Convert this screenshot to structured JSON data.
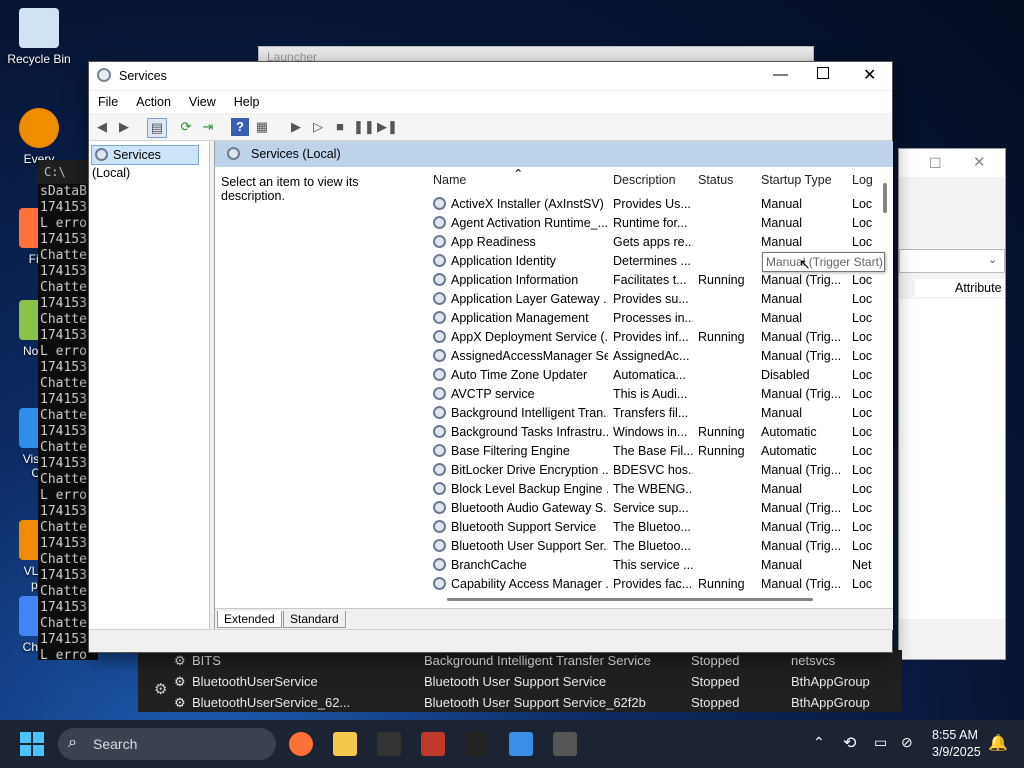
{
  "desktop_icons": [
    {
      "label": "Recycle Bin",
      "icon": "recycle-bin-icon"
    },
    {
      "label": "Every",
      "icon": "everything-search-icon"
    },
    {
      "label": "Fire",
      "icon": "firefox-icon"
    },
    {
      "label": "Notep",
      "icon": "notepad-icon"
    },
    {
      "label": "Visual",
      "label2": "Co",
      "icon": "vscode-icon"
    },
    {
      "label": "VLC r",
      "label2": "pla",
      "icon": "vlc-icon"
    },
    {
      "label": "Chron",
      "icon": "chrome-icon"
    }
  ],
  "console": {
    "title": "C:\\",
    "lines": [
      "sDataB",
      "174153",
      "L erro",
      "174153",
      "Chatte",
      "174153",
      "Chatte",
      "174153",
      "Chatte",
      "174153",
      "L erro",
      "174153",
      "Chatte",
      "174153",
      "Chatte",
      "174153",
      "Chatte",
      "174153",
      "Chatte",
      "L erro",
      "174153",
      "Chatte",
      "174153",
      "Chatte",
      "174153",
      "Chatte",
      "174153",
      "Chatte",
      "174153",
      "L erro"
    ]
  },
  "background_window": {
    "title": "Launcher"
  },
  "right_window": {
    "column_header": "Attribute"
  },
  "bottom_list": {
    "rows": [
      {
        "name": "BITS",
        "description": "Background Intelligent Transfer Service",
        "status": "Stopped",
        "group": "netsvcs"
      },
      {
        "name": "BluetoothUserService",
        "description": "Bluetooth User Support Service",
        "status": "Stopped",
        "group": "BthAppGroup"
      },
      {
        "name": "BluetoothUserService_62...",
        "description": "Bluetooth User Support Service_62f2b",
        "status": "Stopped",
        "group": "BthAppGroup"
      }
    ]
  },
  "services_window": {
    "title": "Services",
    "menu": [
      "File",
      "Action",
      "View",
      "Help"
    ],
    "tree_root": "Services (Local)",
    "panel_title": "Services (Local)",
    "description_prompt": "Select an item to view its description.",
    "columns": [
      "Name",
      "Description",
      "Status",
      "Startup Type",
      "Log"
    ],
    "rows": [
      {
        "name": "ActiveX Installer (AxInstSV)",
        "description": "Provides Us...",
        "status": "",
        "startup": "Manual",
        "log": "Loc"
      },
      {
        "name": "Agent Activation Runtime_...",
        "description": "Runtime for...",
        "status": "",
        "startup": "Manual",
        "log": "Loc"
      },
      {
        "name": "App Readiness",
        "description": "Gets apps re...",
        "status": "",
        "startup": "Manual",
        "log": "Loc"
      },
      {
        "name": "Application Identity",
        "description": "Determines ...",
        "status": "",
        "startup": "",
        "log": ""
      },
      {
        "name": "Application Information",
        "description": "Facilitates t...",
        "status": "Running",
        "startup": "Manual (Trig...",
        "log": "Loc"
      },
      {
        "name": "Application Layer Gateway ...",
        "description": "Provides su...",
        "status": "",
        "startup": "Manual",
        "log": "Loc"
      },
      {
        "name": "Application Management",
        "description": "Processes in...",
        "status": "",
        "startup": "Manual",
        "log": "Loc"
      },
      {
        "name": "AppX Deployment Service (...",
        "description": "Provides inf...",
        "status": "Running",
        "startup": "Manual (Trig...",
        "log": "Loc"
      },
      {
        "name": "AssignedAccessManager Se...",
        "description": "AssignedAc...",
        "status": "",
        "startup": "Manual (Trig...",
        "log": "Loc"
      },
      {
        "name": "Auto Time Zone Updater",
        "description": "Automatica...",
        "status": "",
        "startup": "Disabled",
        "log": "Loc"
      },
      {
        "name": "AVCTP service",
        "description": "This is Audi...",
        "status": "",
        "startup": "Manual (Trig...",
        "log": "Loc"
      },
      {
        "name": "Background Intelligent Tran...",
        "description": "Transfers fil...",
        "status": "",
        "startup": "Manual",
        "log": "Loc"
      },
      {
        "name": "Background Tasks Infrastru...",
        "description": "Windows in...",
        "status": "Running",
        "startup": "Automatic",
        "log": "Loc"
      },
      {
        "name": "Base Filtering Engine",
        "description": "The Base Fil...",
        "status": "Running",
        "startup": "Automatic",
        "log": "Loc"
      },
      {
        "name": "BitLocker Drive Encryption ...",
        "description": "BDESVC hos...",
        "status": "",
        "startup": "Manual (Trig...",
        "log": "Loc"
      },
      {
        "name": "Block Level Backup Engine ...",
        "description": "The WBENG...",
        "status": "",
        "startup": "Manual",
        "log": "Loc"
      },
      {
        "name": "Bluetooth Audio Gateway S...",
        "description": "Service sup...",
        "status": "",
        "startup": "Manual (Trig...",
        "log": "Loc"
      },
      {
        "name": "Bluetooth Support Service",
        "description": "The Bluetoo...",
        "status": "",
        "startup": "Manual (Trig...",
        "log": "Loc"
      },
      {
        "name": "Bluetooth User Support Ser...",
        "description": "The Bluetoo...",
        "status": "",
        "startup": "Manual (Trig...",
        "log": "Loc"
      },
      {
        "name": "BranchCache",
        "description": "This service ...",
        "status": "",
        "startup": "Manual",
        "log": "Net"
      },
      {
        "name": "Capability Access Manager ...",
        "description": "Provides fac...",
        "status": "Running",
        "startup": "Manual (Trig...",
        "log": "Loc"
      }
    ],
    "tooltip": "Manual (Trigger Start)",
    "tabs": [
      "Extended",
      "Standard"
    ]
  },
  "taskbar": {
    "search_placeholder": "Search",
    "time": "8:55 AM",
    "date": "3/9/2025",
    "pinned": [
      "firefox-icon",
      "file-explorer-icon",
      "7zip-icon",
      "app-icon",
      "terminal-icon",
      "task-manager-icon",
      "services-icon"
    ]
  }
}
